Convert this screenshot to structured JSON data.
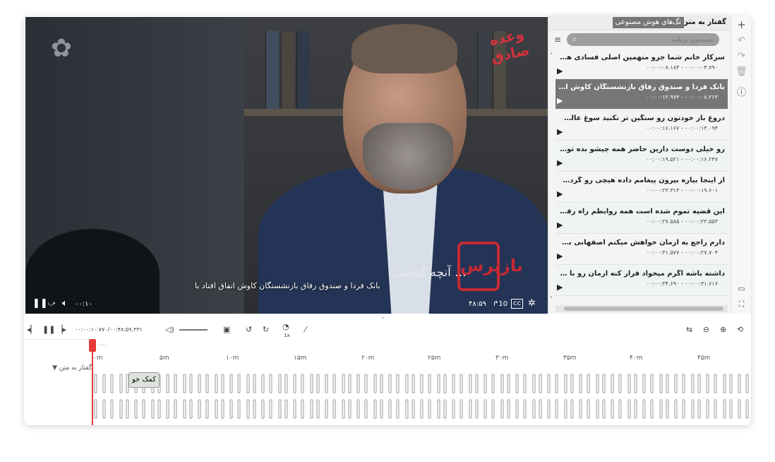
{
  "video": {
    "subtitle": "بانک فردا و صندوق رفاق بازنشستگان کاوش اتفاق افتاد با",
    "overlay_caption": "آنچه گذشت ...",
    "logo_top_right": "وعده صادق",
    "logo_bottom_right": "بازپرس",
    "current_time": "۰۰:۱۰",
    "duration": "۴۸:۵۹",
    "pause_icon": "pause-icon",
    "controls_icons": [
      "pause-icon",
      "skip-icon",
      "volume-icon",
      "forward10-icon",
      "cc-icon",
      "settings-icon"
    ]
  },
  "panel": {
    "tab_active": "گفتار به متن",
    "tab_inactive": "تگ‌های هوش مصنوعی",
    "search_placeholder": "جستجوی برنامه",
    "segments": [
      {
        "text": "سرکار خانم شما جزو متهمین اصلی فسادی هستین ک...",
        "start": "۰۰:۰۰:۰۴.۷۹۰",
        "end": "۰۰:۰۰:۰۸.۱۸۴"
      },
      {
        "text": "بانک فردا و صندوق رفاق بازنشستگان کاوش اتفاق افتا...",
        "start": "۰۰:۰۰:۰۸.۲۶۳",
        "end": "۰۰:۰۰:۱۲.۹۷۴"
      },
      {
        "text": "دروغ بار خودتون رو سنگین تر نکنید سوغ عالی تو",
        "start": "۰۰:۰۰:۱۳.۰۹۴",
        "end": "۰۰:۰۰:۱۶.۱۶۷"
      },
      {
        "text": "رو خیلی دوست دارین حاضر همه چیشو بده تو رو",
        "start": "۰۰:۰۰:۱۶.۲۴۷",
        "end": "۰۰:۰۰:۱۹.۵۲۱"
      },
      {
        "text": "از اینجا بیاره بیرون پیغامم داده هیچی رو گردن نگیر",
        "start": "۰۰:۰۰:۱۹.۶۰۱",
        "end": "۰۰:۰۰:۲۳.۳۱۳"
      },
      {
        "text": "این قضیه تموم شده است همه روابطم راه رفته پیغام",
        "start": "۰۰:۰۰:۲۳.۵۵۳",
        "end": "۰۰:۰۰:۲۷.۵۸۵"
      },
      {
        "text": "دارم راجع به ارمان خواهش میکنم اصفهانی بگین بیای...",
        "start": "۰۰:۰۰:۲۷.۷۰۴",
        "end": "۰۰:۰۰:۳۱.۵۷۷"
      },
      {
        "text": "داشته باشه اگرم میخواد فرار کنه ارمان رو با خودش",
        "start": "۰۰:۰۰:۳۱.۶۱۶",
        "end": "۰۰:۰۰:۳۴.۶۹۰"
      }
    ]
  },
  "toolbar": {
    "timecode": "۰۰:۰۰:۱۰.۷۷۰/۰۰:۴۸:۵۹.۳۳۱",
    "speed": "1x"
  },
  "timeline": {
    "playhead_time": "۰:۰۰",
    "ticks": [
      "۰m",
      "۵m",
      "۱۰m",
      "۱۵m",
      "۲۰m",
      "۲۵m",
      "۳۰m",
      "۳۵m",
      "۴۰m",
      "۴۵m"
    ],
    "track_label": "گفتار به متن",
    "tag_label": "کمک خو"
  }
}
